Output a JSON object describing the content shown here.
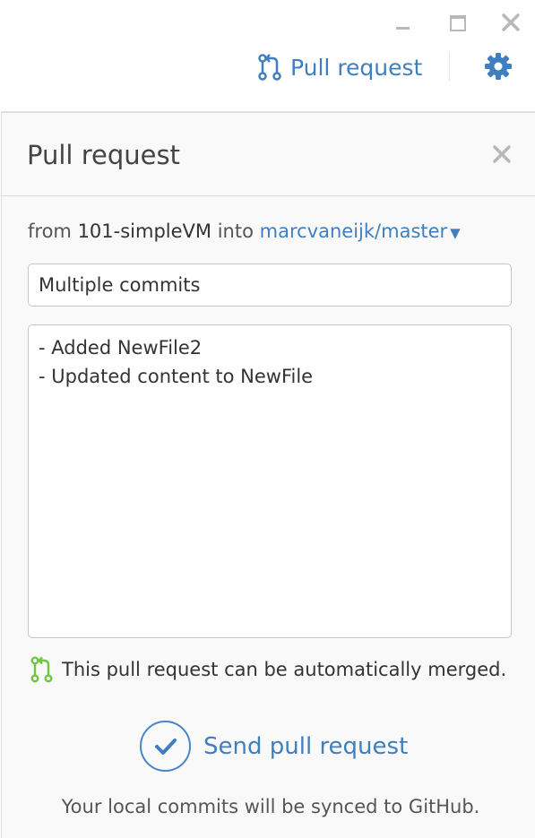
{
  "toolbar": {
    "pull_request_label": "Pull request",
    "icons": [
      "minimize-icon",
      "maximize-icon",
      "close-icon",
      "pull-request-icon",
      "gear-icon"
    ]
  },
  "panel": {
    "title": "Pull request",
    "from_text": "from",
    "source_branch": "101-simpleVM",
    "into_text": "into",
    "target_branch": "marcvaneijk/master",
    "title_value": "Multiple commits",
    "title_placeholder": "",
    "body_value": "- Added NewFile2\n- Updated content to NewFile",
    "merge_status": "This pull request can be automatically merged.",
    "send_label": "Send pull request",
    "sync_note": "Your local commits will be synced to GitHub."
  },
  "colors": {
    "accent": "#3f7fbf",
    "merge_ok": "#6cc644",
    "icon_gray": "#b8b8b8"
  }
}
